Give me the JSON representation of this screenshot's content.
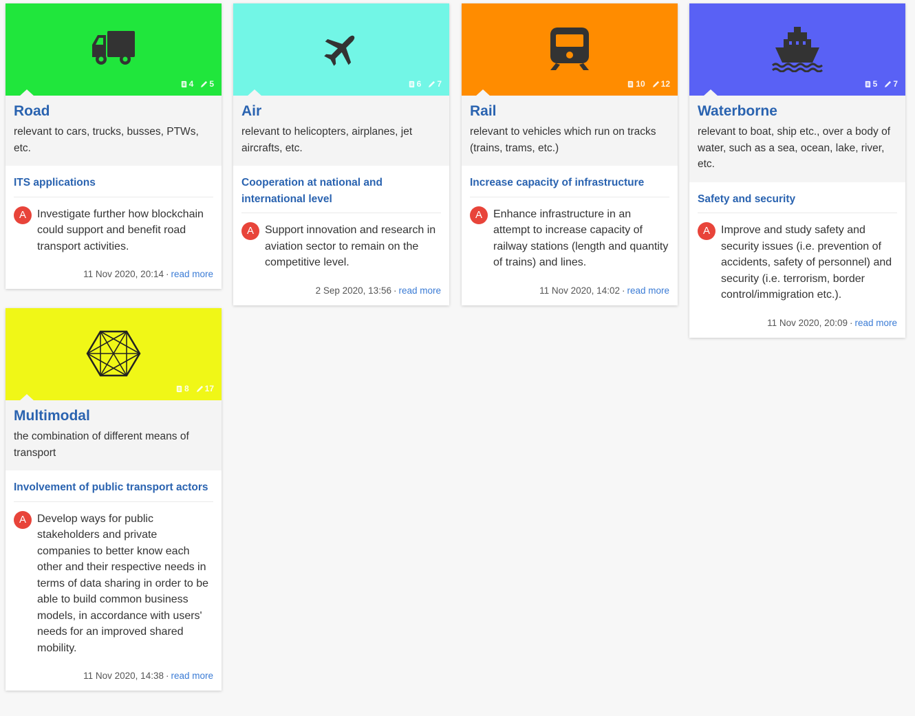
{
  "cards": {
    "road": {
      "color": "#20e63c",
      "icon": "truck-icon",
      "docs": "4",
      "edits": "5",
      "title": "Road",
      "description": "relevant to cars, trucks, busses, PTWs, etc.",
      "topic": "ITS applications",
      "badge": "A",
      "item": "Investigate further how blockchain could support and benefit road transport activities.",
      "date": "11 Nov 2020, 20:14",
      "read_more": "read more"
    },
    "air": {
      "color": "#72f6e6",
      "icon": "airplane-icon",
      "docs": "6",
      "edits": "7",
      "title": "Air",
      "description": "relevant to helicopters, airplanes, jet aircrafts, etc.",
      "topic": "Cooperation at national and international level",
      "badge": "A",
      "item": "Support innovation and research in aviation sector to remain on the competitive level.",
      "date": "2 Sep 2020, 13:56",
      "read_more": "read more"
    },
    "rail": {
      "color": "#ff8c00",
      "icon": "train-icon",
      "docs": "10",
      "edits": "12",
      "title": "Rail",
      "description": "relevant to vehicles which run on tracks (trains, trams, etc.)",
      "topic": "Increase capacity of infrastructure",
      "badge": "A",
      "item": "Enhance infrastructure in an attempt to increase capacity of railway stations (length and quantity of trains) and lines.",
      "date": "11 Nov 2020, 14:02",
      "read_more": "read more"
    },
    "waterborne": {
      "color": "#5961f5",
      "icon": "ship-icon",
      "docs": "5",
      "edits": "7",
      "title": "Waterborne",
      "description": "relevant to boat, ship etc., over a body of water, such as a sea, ocean, lake, river, etc.",
      "topic": "Safety and security",
      "badge": "A",
      "item": "Improve and study safety and security issues (i.e. prevention of accidents, safety of personnel) and security (i.e. terrorism, border control/immigration etc.).",
      "date": "11 Nov 2020, 20:09",
      "read_more": "read more"
    },
    "multimodal": {
      "color": "#f0f717",
      "icon": "network-hexagon-icon",
      "docs": "8",
      "edits": "17",
      "title": "Multimodal",
      "description": "the combination of different means of transport",
      "topic": "Involvement of public transport actors",
      "badge": "A",
      "item": "Develop ways for public stakeholders and private companies to better know each other and their respective needs in terms of data sharing in order to be able to build common business models, in accordance with users' needs for an improved shared mobility.",
      "date": "11 Nov 2020, 14:38",
      "read_more": "read more"
    }
  }
}
